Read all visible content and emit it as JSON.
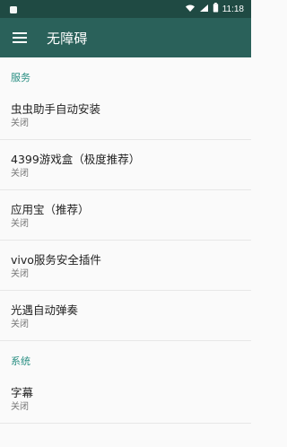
{
  "status_bar": {
    "time": "11:18"
  },
  "app_bar": {
    "title": "无障碍"
  },
  "sections": [
    {
      "header": "服务",
      "items": [
        {
          "title": "虫虫助手自动安装",
          "status": "关闭"
        },
        {
          "title": "4399游戏盒（极度推荐）",
          "status": "关闭"
        },
        {
          "title": "应用宝（推荐）",
          "status": "关闭"
        },
        {
          "title": "vivo服务安全插件",
          "status": "关闭"
        },
        {
          "title": "光遇自动弹奏",
          "status": "关闭"
        }
      ]
    },
    {
      "header": "系统",
      "items": [
        {
          "title": "字幕",
          "status": "关闭"
        }
      ]
    }
  ],
  "colors": {
    "status_bar": "#1f4a43",
    "app_bar": "#2a615a",
    "section_header": "#2a8f83"
  },
  "icons": {
    "status_left": "notification-icon",
    "wifi": "wifi-icon",
    "signal": "signal-icon",
    "battery": "battery-icon",
    "menu": "menu-icon"
  }
}
